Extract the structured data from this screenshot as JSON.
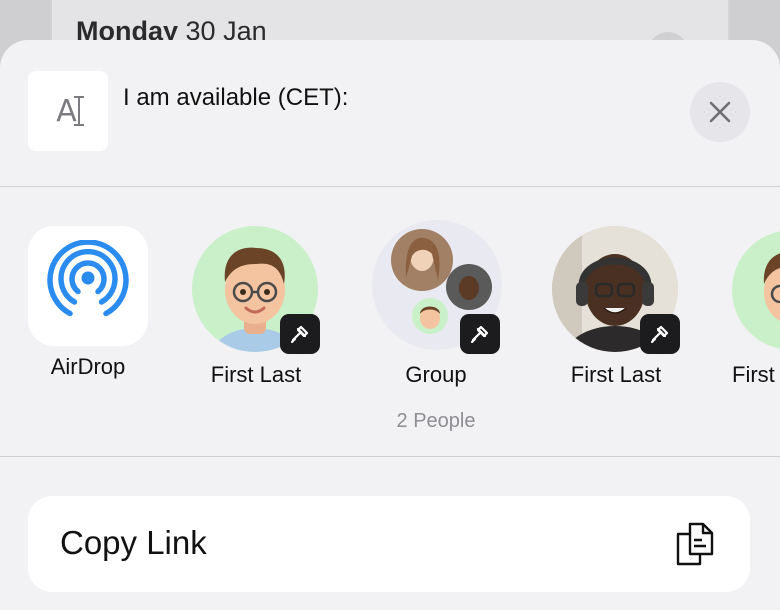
{
  "background": {
    "date_day": "Monday",
    "date_rest": "30 Jan"
  },
  "sheet": {
    "preview_thumb_text": "A",
    "title": "I am available (CET):",
    "close_icon": "close-icon"
  },
  "targets": [
    {
      "label": "AirDrop",
      "sublabel": "",
      "icon": "airdrop-icon"
    },
    {
      "label": "First Last",
      "sublabel": "",
      "icon": "memoji-avatar",
      "badge_icon": "app-badge-icon"
    },
    {
      "label": "Group",
      "sublabel": "2 People",
      "icon": "group-avatar",
      "badge_icon": "app-badge-icon"
    },
    {
      "label": "First Last",
      "sublabel": "",
      "icon": "photo-avatar",
      "badge_icon": "app-badge-icon"
    },
    {
      "label": "First Last",
      "sublabel": "",
      "icon": "memoji-avatar"
    }
  ],
  "actions": {
    "copy_link_label": "Copy Link",
    "copy_link_icon": "copy-documents-icon"
  },
  "colors": {
    "airdrop_blue": "#2b8cf0",
    "avatar_green": "#c9f0c8",
    "badge_dark": "#1c1c1e",
    "sheet_bg": "#f2f2f4"
  }
}
